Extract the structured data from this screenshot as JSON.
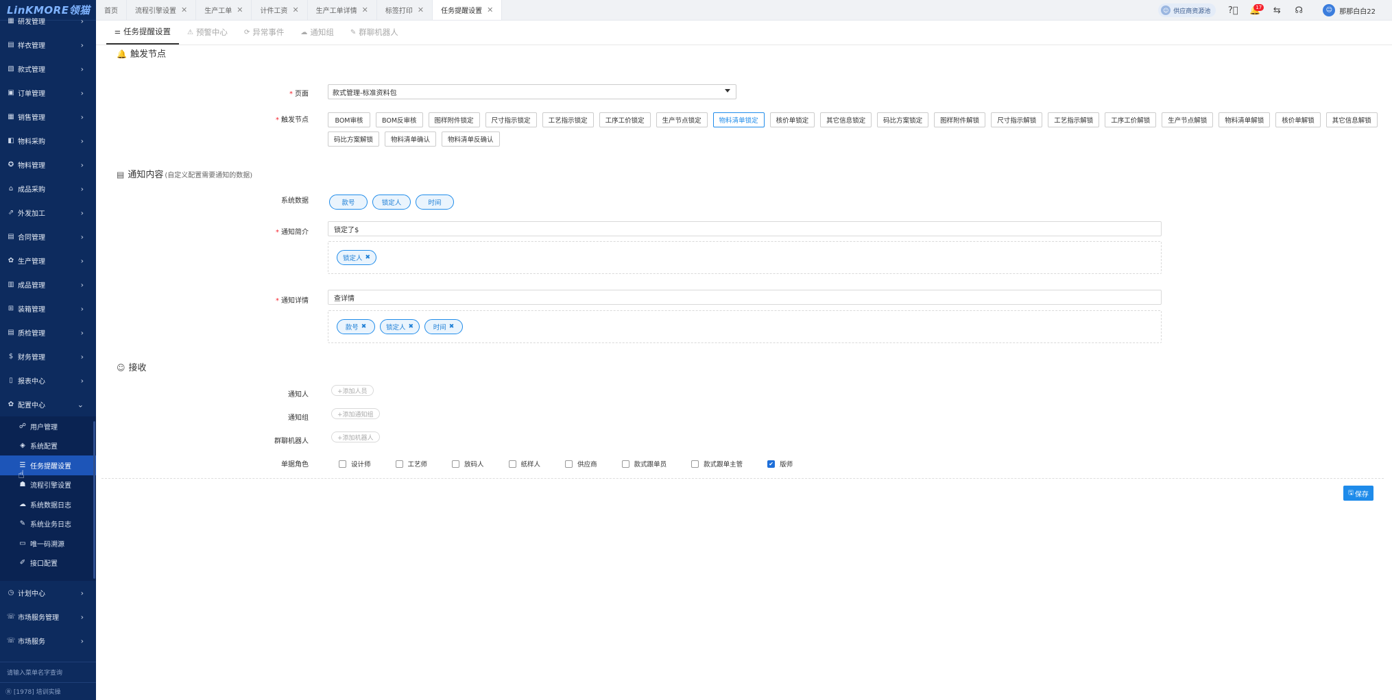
{
  "app": {
    "logo": "LinKMORE领猫"
  },
  "sidebar": {
    "items_top": [
      {
        "label": "研发管理",
        "icon": "▦"
      },
      {
        "label": "样衣管理",
        "icon": "▤"
      },
      {
        "label": "款式管理",
        "icon": "▧"
      },
      {
        "label": "订单管理",
        "icon": "▣"
      },
      {
        "label": "销售管理",
        "icon": "▦"
      },
      {
        "label": "物料采购",
        "icon": "◧"
      },
      {
        "label": "物料管理",
        "icon": "✪"
      },
      {
        "label": "成品采购",
        "icon": "⌂"
      },
      {
        "label": "外发加工",
        "icon": "⇗"
      },
      {
        "label": "合同管理",
        "icon": "▤"
      },
      {
        "label": "生产管理",
        "icon": "✿"
      },
      {
        "label": "成品管理",
        "icon": "▥"
      },
      {
        "label": "装箱管理",
        "icon": "⊞"
      },
      {
        "label": "质检管理",
        "icon": "▤"
      },
      {
        "label": "财务管理",
        "icon": "$"
      },
      {
        "label": "报表中心",
        "icon": "▯"
      }
    ],
    "open_group": {
      "label": "配置中心",
      "icon": "✿",
      "chevron": "⌄"
    },
    "sub_items": [
      {
        "label": "用户管理",
        "icon": "☍"
      },
      {
        "label": "系统配置",
        "icon": "◈"
      },
      {
        "label": "任务提醒设置",
        "icon": "☰"
      },
      {
        "label": "流程引擎设置",
        "icon": "☗"
      },
      {
        "label": "系统数据日志",
        "icon": "☁"
      },
      {
        "label": "系统业务日志",
        "icon": "✎"
      },
      {
        "label": "唯一码溯源",
        "icon": "▭"
      },
      {
        "label": "接口配置",
        "icon": "✐"
      }
    ],
    "items_bottom": [
      {
        "label": "计划中心",
        "icon": "◷"
      },
      {
        "label": "市场服务管理",
        "icon": "☏"
      },
      {
        "label": "市场服务",
        "icon": "☏"
      }
    ],
    "search_placeholder": "请输入菜单名字查询",
    "footer": "Ⓡ [1978] 培训实操"
  },
  "tabs": [
    {
      "label": "首页",
      "closable": false
    },
    {
      "label": "流程引擎设置",
      "closable": true
    },
    {
      "label": "生产工单",
      "closable": true
    },
    {
      "label": "计件工资",
      "closable": true
    },
    {
      "label": "生产工单详情",
      "closable": true
    },
    {
      "label": "标签打印",
      "closable": true
    },
    {
      "label": "任务提醒设置",
      "closable": true
    }
  ],
  "topright": {
    "vendor": "供应商资源池",
    "notify_count": "17",
    "user": "那那白白22"
  },
  "subtabs": [
    {
      "label": "任务提醒设置",
      "icon": "⚌"
    },
    {
      "label": "预警中心",
      "icon": "⚠"
    },
    {
      "label": "异常事件",
      "icon": "⟳"
    },
    {
      "label": "通知组",
      "icon": "☁"
    },
    {
      "label": "群聊机器人",
      "icon": "✎"
    }
  ],
  "sections": {
    "trigger": {
      "title": "触发节点",
      "icon": "🔔"
    },
    "content": {
      "title": "通知内容",
      "note": "(自定义配置需要通知的数据)",
      "icon": "▤"
    },
    "receive": {
      "title": "接收",
      "icon": "☺"
    }
  },
  "form": {
    "page_label": "页面",
    "page_value": "款式管理-标准资料包",
    "trigger_label": "触发节点",
    "triggers": [
      "BOM审核",
      "BOM反审核",
      "图样附件锁定",
      "尺寸指示锁定",
      "工艺指示锁定",
      "工序工价锁定",
      "生产节点锁定",
      "物料清单锁定",
      "核价单锁定",
      "其它信息锁定",
      "码比方案锁定",
      "图样附件解锁",
      "尺寸指示解锁",
      "工艺指示解锁",
      "工序工价解锁",
      "生产节点解锁",
      "物料清单解锁",
      "核价单解锁",
      "其它信息解锁",
      "码比方案解锁",
      "物料清单确认",
      "物料清单反确认"
    ],
    "trigger_selected": "物料清单锁定",
    "sys_label": "系统数据",
    "sys_fields": [
      "款号",
      "锁定人",
      "时间"
    ],
    "brief_label": "通知简介",
    "brief_value": "锁定了$",
    "brief_tags": [
      "锁定人"
    ],
    "detail_label": "通知详情",
    "detail_value": "查详情",
    "detail_tags": [
      "款号",
      "锁定人",
      "时间"
    ],
    "tag_remove": "✖",
    "notify_person_label": "通知人",
    "notify_person_btn": "+添加人员",
    "notify_group_label": "通知组",
    "notify_group_btn": "+添加通知组",
    "robot_label": "群聊机器人",
    "robot_btn": "+添加机器人",
    "roles_label": "单据角色",
    "roles": [
      {
        "label": "设计师",
        "checked": false
      },
      {
        "label": "工艺师",
        "checked": false
      },
      {
        "label": "放码人",
        "checked": false
      },
      {
        "label": "纸样人",
        "checked": false
      },
      {
        "label": "供应商",
        "checked": false
      },
      {
        "label": "款式跟单员",
        "checked": false
      },
      {
        "label": "款式跟单主管",
        "checked": false
      },
      {
        "label": "版师",
        "checked": true
      }
    ],
    "save": "保存",
    "save_icon": "🖫"
  },
  "colors": {
    "accent": "#1e8bea",
    "sidebar": "#0d2b5e",
    "sidebar_active": "#1d55b8"
  }
}
